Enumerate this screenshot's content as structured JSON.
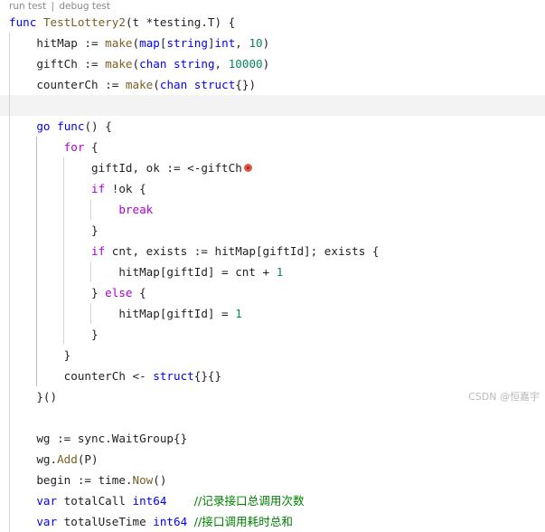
{
  "codelens": {
    "run_test": "run test",
    "separator": "|",
    "debug_test": "debug test"
  },
  "code": {
    "l1": [
      "func",
      "TestLottery2",
      "(t *testing.T) {"
    ],
    "l2": [
      "hitMap := ",
      "make",
      "(",
      "map",
      "[",
      "string",
      "]",
      "int",
      ", ",
      "10",
      ")"
    ],
    "l3": [
      "giftCh := ",
      "make",
      "(",
      "chan",
      " ",
      "string",
      ", ",
      "10000",
      ")"
    ],
    "l4": [
      "counterCh := ",
      "make",
      "(",
      "chan",
      " ",
      "struct",
      "{})"
    ],
    "l6": [
      "go",
      " ",
      "func",
      "() {"
    ],
    "l7": [
      "for",
      " {"
    ],
    "l8": [
      "giftId, ok := <-giftCh"
    ],
    "l9": [
      "if",
      " !ok {"
    ],
    "l10": [
      "break"
    ],
    "l11": [
      "}"
    ],
    "l12": [
      "if",
      " cnt, exists := hitMap[giftId]; exists {"
    ],
    "l13": [
      "hitMap[giftId] = cnt + ",
      "1"
    ],
    "l14": [
      "} ",
      "else",
      " {"
    ],
    "l15": [
      "hitMap[giftId] = ",
      "1"
    ],
    "l16": [
      "}"
    ],
    "l17": [
      "}"
    ],
    "l18": [
      "counterCh <- ",
      "struct",
      "{}{}"
    ],
    "l19": [
      "}()"
    ],
    "l21": [
      "wg := sync.WaitGroup{}"
    ],
    "l22": [
      "wg.",
      "Add",
      "(P)"
    ],
    "l23": [
      "begin := time.",
      "Now",
      "()"
    ],
    "l24": [
      "var",
      " totalCall ",
      "int64",
      "    ",
      "//记录接口总调用次数"
    ],
    "l25": [
      "var",
      " totalUseTime ",
      "int64",
      " ",
      "//接口调用耗时总和"
    ]
  },
  "watermark": "CSDN @恒嘉宇",
  "colors": {
    "keyword": "#0000ff",
    "control": "#af00db",
    "function": "#795e26",
    "type": "#267f99",
    "number": "#098658",
    "comment": "#008000",
    "breakpoint": "#e05545"
  },
  "icons": {
    "breakpoint": "breakpoint-dot-icon"
  }
}
